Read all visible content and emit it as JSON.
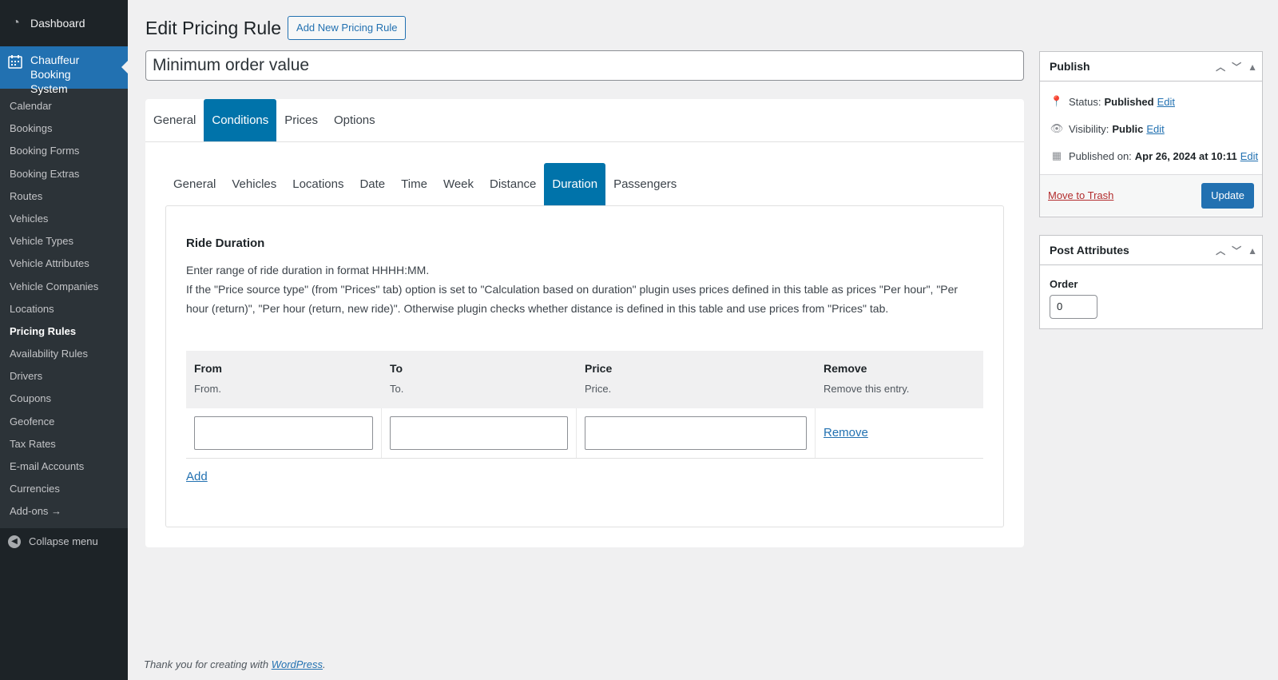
{
  "sidebar": {
    "dashboard": "Dashboard",
    "plugin": "Chauffeur Booking System",
    "items": [
      {
        "label": "Calendar"
      },
      {
        "label": "Bookings"
      },
      {
        "label": "Booking Forms"
      },
      {
        "label": "Booking Extras"
      },
      {
        "label": "Routes"
      },
      {
        "label": "Vehicles"
      },
      {
        "label": "Vehicle Types"
      },
      {
        "label": "Vehicle Attributes"
      },
      {
        "label": "Vehicle Companies"
      },
      {
        "label": "Locations"
      },
      {
        "label": "Pricing Rules"
      },
      {
        "label": "Availability Rules"
      },
      {
        "label": "Drivers"
      },
      {
        "label": "Coupons"
      },
      {
        "label": "Geofence"
      },
      {
        "label": "Tax Rates"
      },
      {
        "label": "E-mail Accounts"
      },
      {
        "label": "Currencies"
      },
      {
        "label": "Add-ons →"
      }
    ],
    "current": "Pricing Rules",
    "collapse": "Collapse menu"
  },
  "header": {
    "title": "Edit Pricing Rule",
    "add_new": "Add New Pricing Rule"
  },
  "post_title": "Minimum order value",
  "tabs": [
    {
      "label": "General"
    },
    {
      "label": "Conditions"
    },
    {
      "label": "Prices"
    },
    {
      "label": "Options"
    }
  ],
  "subtabs": [
    {
      "label": "General"
    },
    {
      "label": "Vehicles"
    },
    {
      "label": "Locations"
    },
    {
      "label": "Date"
    },
    {
      "label": "Time"
    },
    {
      "label": "Week"
    },
    {
      "label": "Distance"
    },
    {
      "label": "Duration"
    },
    {
      "label": "Passengers"
    }
  ],
  "active_tab": "Conditions",
  "active_subtab": "Duration",
  "section": {
    "title": "Ride Duration",
    "line1": "Enter range of ride duration in format HHHH:MM.",
    "line2": "If the \"Price source type\" (from \"Prices\" tab) option is set to \"Calculation based on duration\" plugin uses prices defined in this table as prices \"Per hour\", \"Per hour (return)\", \"Per hour (return, new ride)\". Otherwise plugin checks whether distance is defined in this table and use prices from \"Prices\" tab."
  },
  "table": {
    "columns": [
      {
        "title": "From",
        "desc": "From."
      },
      {
        "title": "To",
        "desc": "To."
      },
      {
        "title": "Price",
        "desc": "Price."
      },
      {
        "title": "Remove",
        "desc": "Remove this entry."
      }
    ],
    "row": {
      "from": "",
      "to": "",
      "price": "",
      "remove": "Remove"
    },
    "add": "Add"
  },
  "publish": {
    "title": "Publish",
    "status_label": "Status:",
    "status_value": "Published",
    "visibility_label": "Visibility:",
    "visibility_value": "Public",
    "published_label": "Published on:",
    "published_value": "Apr 26, 2024 at 10:11",
    "edit": "Edit",
    "trash": "Move to Trash",
    "update": "Update"
  },
  "attributes": {
    "title": "Post Attributes",
    "order_label": "Order",
    "order_value": "0"
  },
  "footer": {
    "text": "Thank you for creating with ",
    "link": "WordPress",
    "end": "."
  }
}
